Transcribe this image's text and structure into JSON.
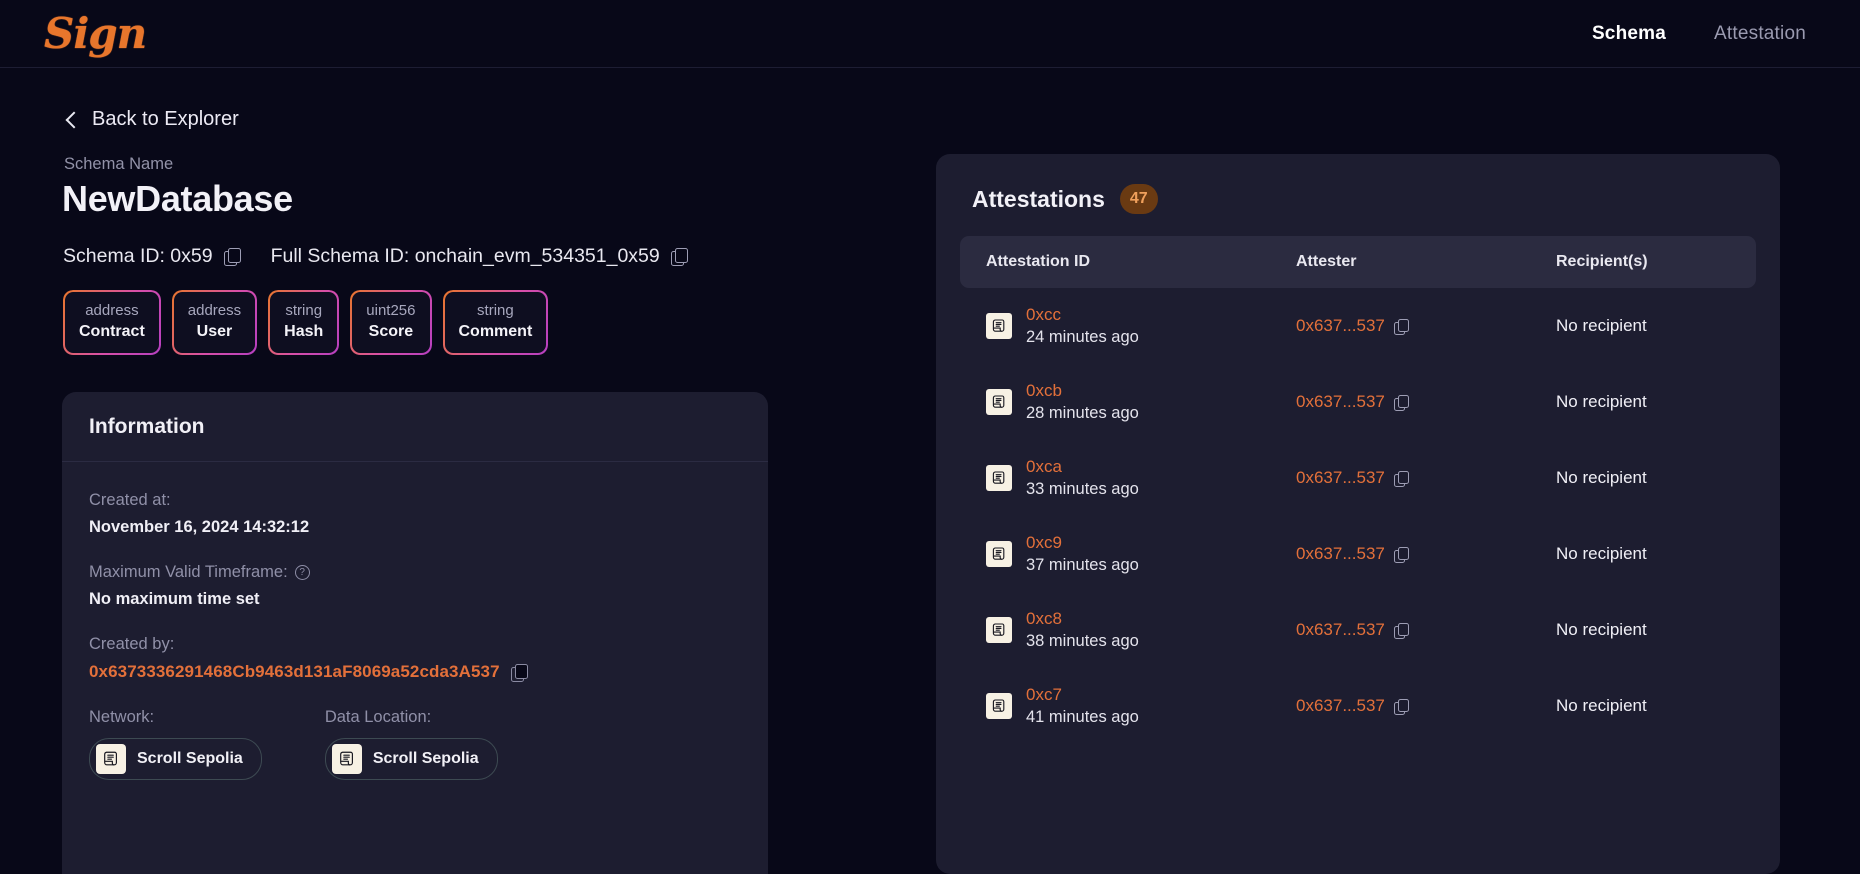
{
  "navbar": {
    "logo_text": "Sign",
    "links": [
      {
        "label": "Schema",
        "active": true
      },
      {
        "label": "Attestation",
        "active": false
      }
    ]
  },
  "back_link": {
    "label": "Back to Explorer",
    "icon": "chevron-left-icon"
  },
  "schema": {
    "name_label": "Schema Name",
    "name": "NewDatabase",
    "schema_id_text": "Schema ID: 0x59",
    "full_schema_id_text": "Full Schema ID: onchain_evm_534351_0x59",
    "fields": [
      {
        "type": "address",
        "name": "Contract"
      },
      {
        "type": "address",
        "name": "User"
      },
      {
        "type": "string",
        "name": "Hash"
      },
      {
        "type": "uint256",
        "name": "Score"
      },
      {
        "type": "string",
        "name": "Comment"
      }
    ]
  },
  "information": {
    "title": "Information",
    "created_at_label": "Created at:",
    "created_at_value": "November 16, 2024 14:32:12",
    "max_timeframe_label": "Maximum Valid Timeframe:",
    "max_timeframe_value": "No maximum time set",
    "created_by_label": "Created by:",
    "created_by_value": "0x6373336291468Cb9463d131aF8069a52cda3A537",
    "network_label": "Network:",
    "network_value": "Scroll Sepolia",
    "data_location_label": "Data Location:",
    "data_location_value": "Scroll Sepolia"
  },
  "attestations": {
    "title": "Attestations",
    "count": "47",
    "columns": {
      "id": "Attestation ID",
      "attester": "Attester",
      "recipients": "Recipient(s)"
    },
    "rows": [
      {
        "id": "0xcc",
        "time": "24 minutes ago",
        "attester": "0x637...537",
        "recipient": "No recipient"
      },
      {
        "id": "0xcb",
        "time": "28 minutes ago",
        "attester": "0x637...537",
        "recipient": "No recipient"
      },
      {
        "id": "0xca",
        "time": "33 minutes ago",
        "attester": "0x637...537",
        "recipient": "No recipient"
      },
      {
        "id": "0xc9",
        "time": "37 minutes ago",
        "attester": "0x637...537",
        "recipient": "No recipient"
      },
      {
        "id": "0xc8",
        "time": "38 minutes ago",
        "attester": "0x637...537",
        "recipient": "No recipient"
      },
      {
        "id": "0xc7",
        "time": "41 minutes ago",
        "attester": "0x637...537",
        "recipient": "No recipient"
      }
    ]
  },
  "colors": {
    "page_bg": "#080818",
    "panel_bg": "#1d1d30",
    "table_header_bg": "#2b2b40",
    "accent_orange": "#e3703a",
    "logo_orange": "#e8762c",
    "badge_bg": "#6a3a12",
    "badge_text": "#f0a05c",
    "muted_text": "#9090a8"
  }
}
